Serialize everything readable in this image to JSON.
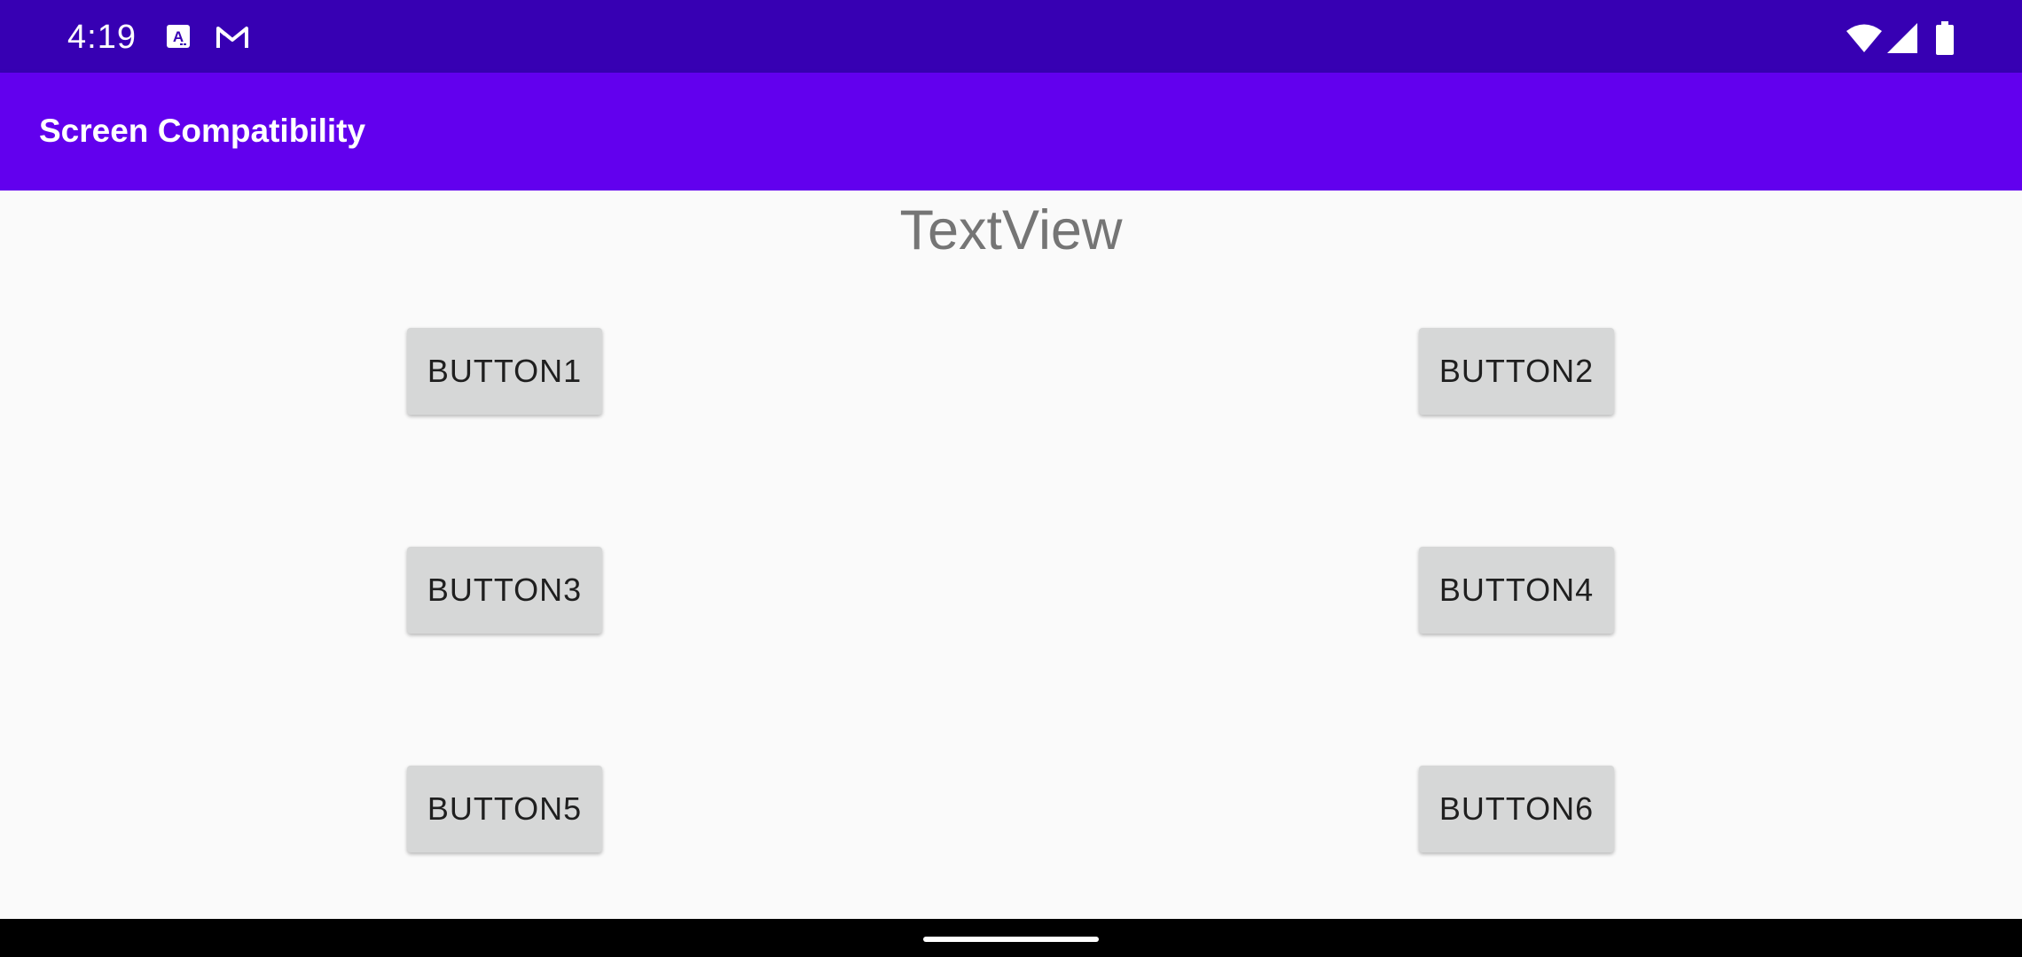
{
  "status_bar": {
    "time": "4:19",
    "background_color": "#3700b3",
    "notification_icons": [
      "accessibility-a-icon",
      "gmail-icon"
    ],
    "system_icons": [
      "wifi-icon",
      "cellular-signal-icon",
      "battery-icon"
    ]
  },
  "app_bar": {
    "title": "Screen Compatibility",
    "background_color": "#6200ee"
  },
  "main": {
    "text_view": "TextView",
    "buttons": [
      {
        "label": "BUTTON1"
      },
      {
        "label": "BUTTON2"
      },
      {
        "label": "BUTTON3"
      },
      {
        "label": "BUTTON4"
      },
      {
        "label": "BUTTON5"
      },
      {
        "label": "BUTTON6"
      }
    ]
  }
}
